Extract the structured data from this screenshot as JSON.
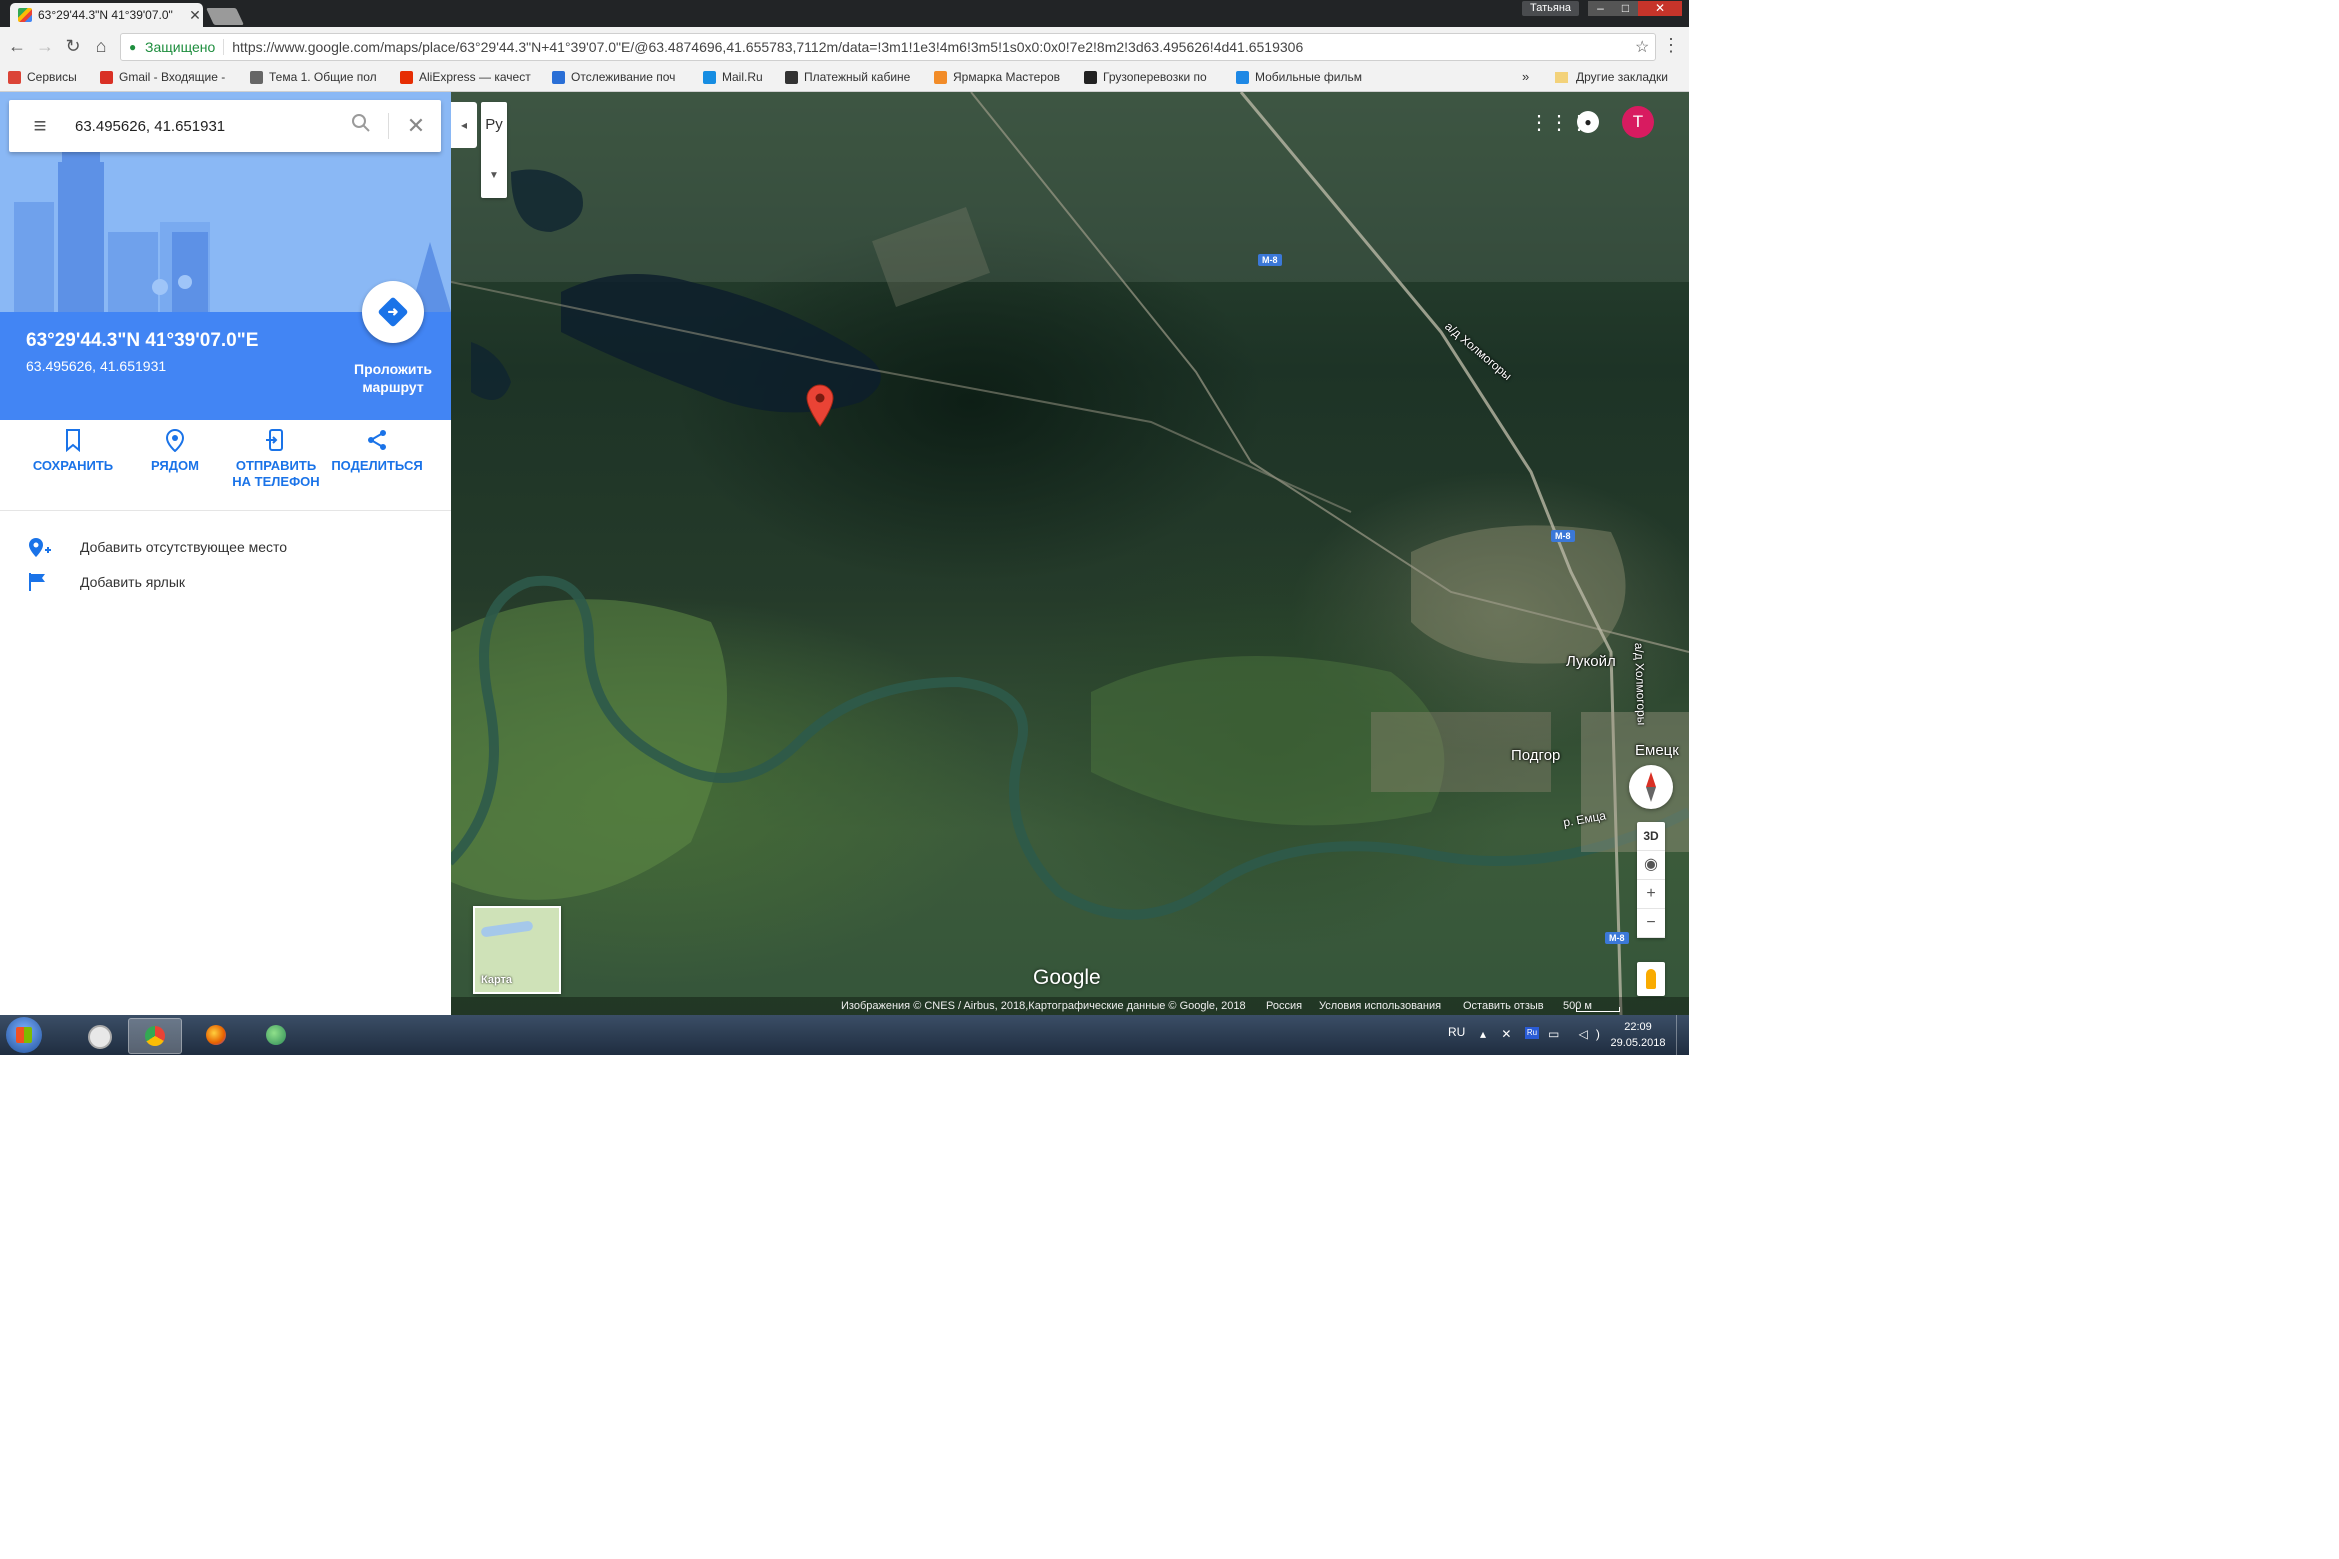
{
  "browser": {
    "tab_title": "63°29'44.3\"N 41°39'07.0\"",
    "user_name": "Татьяна",
    "secure_label": "Защищено",
    "url": "https://www.google.com/maps/place/63°29'44.3\"N+41°39'07.0\"E/@63.4874696,41.655783,7112m/data=!3m1!1e3!4m6!3m5!1s0x0:0x0!7e2!8m2!3d63.495626!4d41.6519306",
    "bookmarks": [
      {
        "label": "Сервисы",
        "icon": "apps-grid-icon",
        "color": "#db4437"
      },
      {
        "label": "Gmail - Входящие -",
        "icon": "gmail-icon",
        "color": "#d93025"
      },
      {
        "label": "Тема 1. Общие пол",
        "icon": "forum-icon",
        "color": "#666666"
      },
      {
        "label": "AliExpress — качест",
        "icon": "aliexpress-icon",
        "color": "#e62e04"
      },
      {
        "label": "Отслеживание поч",
        "icon": "tracking-icon",
        "color": "#2a6fd6"
      },
      {
        "label": "Mail.Ru",
        "icon": "mailru-icon",
        "color": "#168de2"
      },
      {
        "label": "Платежный кабине",
        "icon": "payment-icon",
        "color": "#333333"
      },
      {
        "label": "Ярмарка Мастеров",
        "icon": "craft-fair-icon",
        "color": "#f28c28"
      },
      {
        "label": "Грузоперевозки по",
        "icon": "cargo-icon",
        "color": "#222222"
      },
      {
        "label": "Мобильные фильм",
        "icon": "mobile-films-icon",
        "color": "#1e88e5"
      }
    ],
    "bookmarks_more": "»",
    "other_bookmarks": "Другие закладки"
  },
  "panel": {
    "search_value": "63.495626, 41.651931",
    "place_title": "63°29'44.3\"N 41°39'07.0\"E",
    "place_coords": "63.495626, 41.651931",
    "directions_label": "Проложить маршрут",
    "actions": {
      "save": "СОХРАНИТЬ",
      "nearby": "РЯДОМ",
      "send_to_phone": "ОТПРАВИТЬ НА ТЕЛЕФОН",
      "share": "ПОДЕЛИТЬСЯ"
    },
    "links": {
      "add_missing_place": "Добавить отсутствующее место",
      "add_label": "Добавить ярлык"
    },
    "accent_color": "#4285f4"
  },
  "map": {
    "language_label": "Ру",
    "avatar_letter": "Т",
    "avatar_color": "#d81b60",
    "labels": {
      "lukoil": "Лукойл",
      "podgor": "Подгор",
      "emetsk": "Емецк",
      "river": "р. Емца",
      "road_upper": "а/д Холмогоры",
      "road_lower": "а/д Холмогоры"
    },
    "highway_shield": "М-8",
    "control_3d": "3D",
    "zoom_in": "+",
    "zoom_out": "−",
    "minimap_label": "Карта",
    "google_logo": "Google",
    "attribution": {
      "imagery": "Изображения © CNES / Airbus, 2018,Картографические данные © Google, 2018",
      "country": "Россия",
      "terms": "Условия использования",
      "feedback": "Оставить отзыв",
      "scale": "500 м"
    },
    "marker_color": "#ea4335"
  },
  "taskbar": {
    "language": "RU",
    "lang_badge": "Ru",
    "time": "22:09",
    "date": "29.05.2018"
  }
}
